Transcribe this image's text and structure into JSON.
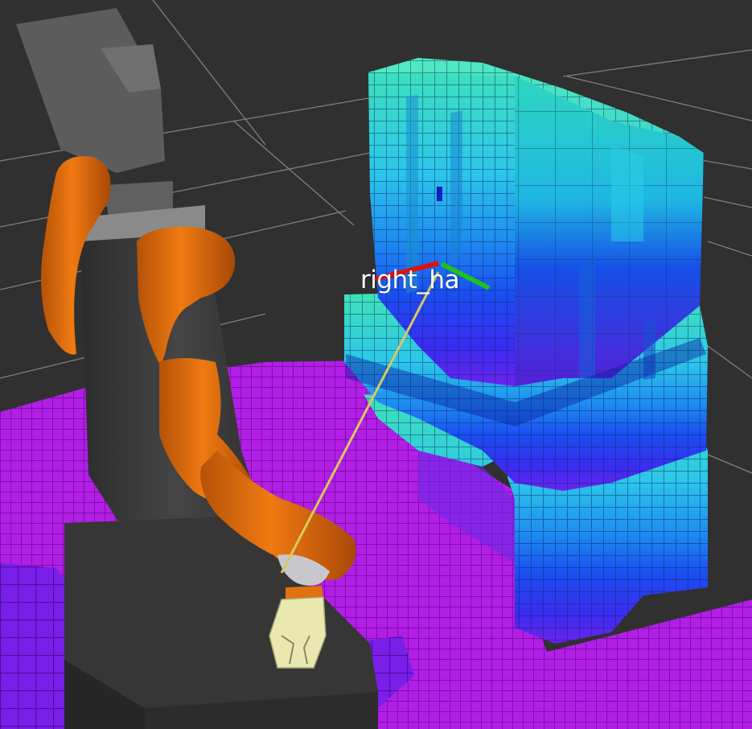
{
  "viewer": {
    "background_color": "#303030",
    "grid_color": "#a0a0a0",
    "frame_label": "right_ha"
  },
  "scene": {
    "floor_voxel_color": "#b020e8",
    "object_voxel_color_top": "#40e0b0",
    "object_voxel_color_mid": "#1878f0",
    "object_voxel_color_low": "#1838e8",
    "robot_arm_color": "#e07010",
    "robot_base_color": "#3a3a3a",
    "gripper_color": "#e8e8b0",
    "frame_axes": {
      "x_color": "#e01010",
      "y_color": "#20c020",
      "z_color": "#1020c0"
    },
    "ray_color": "#d8c860"
  }
}
